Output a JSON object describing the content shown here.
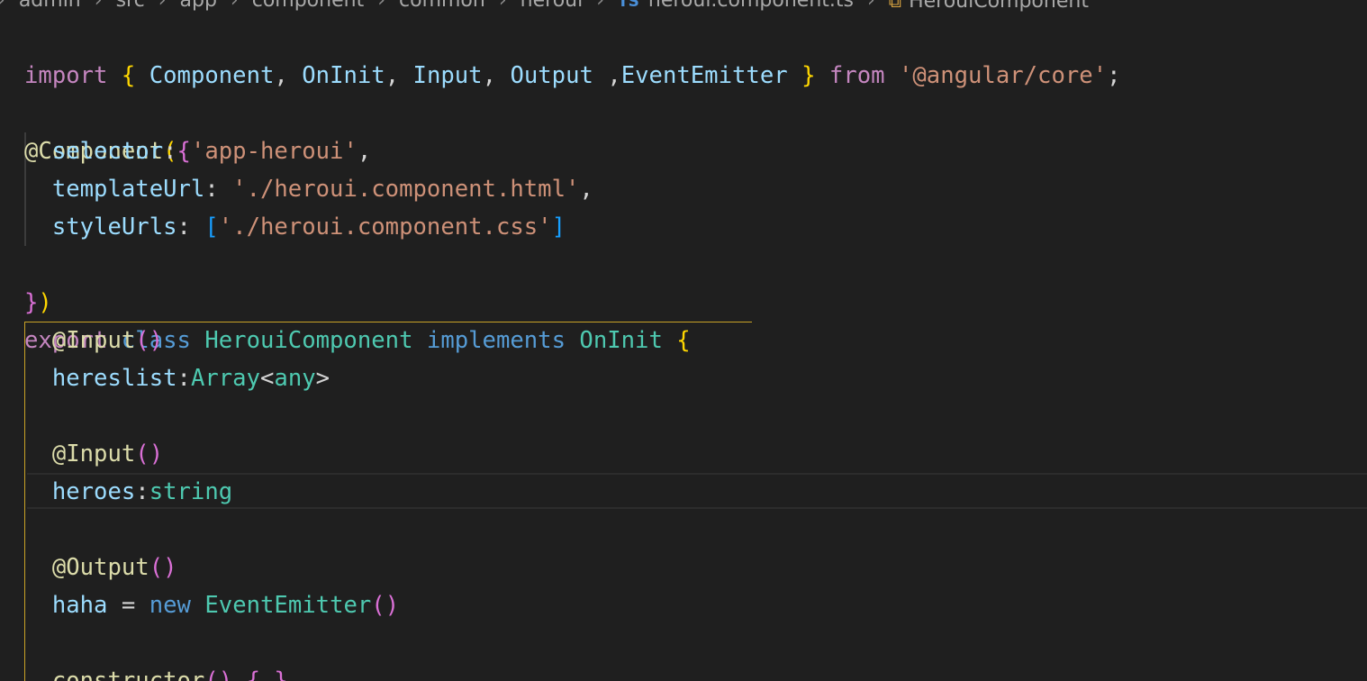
{
  "breadcrumb": {
    "items": [
      "admin",
      "src",
      "app",
      "component",
      "common",
      "heroui"
    ],
    "file": "heroui.component.ts",
    "file_icon": "TS",
    "symbol": "HerouiComponent",
    "lead_sep": "›",
    "sep": "›"
  },
  "code": {
    "l1_import": "import",
    "l1_ob": "{",
    "l1_component": "Component",
    "l1_c1": ",",
    "l1_oninit": "OnInit",
    "l1_c2": ",",
    "l1_input": "Input",
    "l1_c3": ",",
    "l1_output": "Output",
    "l1_c4": ",",
    "l1_emitter": "EventEmitter",
    "l1_cb": "}",
    "l1_from": "from",
    "l1_module": "'@angular/core'",
    "l1_semi": ";",
    "l3_deco": "@Component",
    "l3_paren": "(",
    "l3_brace": "{",
    "l4_key": "selector",
    "l4_colon": ":",
    "l4_val": "'app-heroui'",
    "l4_comma": ",",
    "l5_key": "templateUrl",
    "l5_colon": ":",
    "l5_val": "'./heroui.component.html'",
    "l5_comma": ",",
    "l6_key": "styleUrls",
    "l6_colon": ":",
    "l6_ob": "[",
    "l6_val": "'./heroui.component.css'",
    "l6_cb": "]",
    "l7_brace": "}",
    "l7_paren": ")",
    "l8_export": "export",
    "l8_class": "class",
    "l8_name": "HerouiComponent",
    "l8_implements": "implements",
    "l8_iface": "OnInit",
    "l8_brace": "{",
    "l9_deco": "@Input",
    "l9_parens": "()",
    "l10_prop": "hereslist",
    "l10_colon": ":",
    "l10_type": "Array",
    "l10_lt": "<",
    "l10_any": "any",
    "l10_gt": ">",
    "l12_deco": "@Input",
    "l12_parens": "()",
    "l13_prop": "heroes",
    "l13_colon": ":",
    "l13_type": "string",
    "l15_deco": "@Output",
    "l15_parens": "()",
    "l16_prop": "haha",
    "l16_eq": "=",
    "l16_new": "new",
    "l16_cls": "EventEmitter",
    "l16_parens": "()",
    "l18_ctor": "constructor",
    "l18_parens": "()",
    "l18_ob": "{",
    "l18_cb": "}"
  },
  "colors": {
    "background": "#1f1f1f",
    "keyword": "#c586c0",
    "storage": "#569cd6",
    "identifier": "#9cdcfe",
    "type": "#4ec9b0",
    "string": "#ce9178",
    "decorator": "#dcdcaa",
    "bracket_gold": "#ffd700",
    "bracket_orchid": "#da70d6",
    "bracket_blue": "#179fff",
    "bracket_guide": "#c9a227"
  }
}
